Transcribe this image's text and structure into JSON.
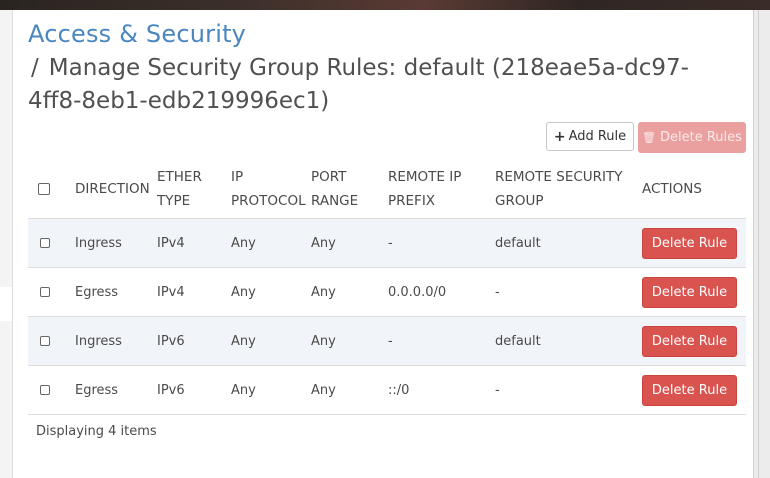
{
  "page": {
    "title": "Access & Security",
    "subtitle_slash": "/",
    "subtitle": "Manage Security Group Rules: default (218eae5a-dc97-4ff8-8eb1-edb219996ec1)"
  },
  "toolbar": {
    "add_rule_icon": "plus-icon",
    "add_rule_label": "Add Rule",
    "delete_rules_icon": "trash-icon",
    "delete_rules_label": "Delete Rules"
  },
  "table": {
    "columns": [
      {
        "line1": "DIRECTION",
        "line2": ""
      },
      {
        "line1": "ETHER",
        "line2": "TYPE"
      },
      {
        "line1": "IP",
        "line2": "PROTOCOL"
      },
      {
        "line1": "PORT",
        "line2": "RANGE"
      },
      {
        "line1": "REMOTE IP",
        "line2": "PREFIX"
      },
      {
        "line1": "REMOTE SECURITY",
        "line2": "GROUP"
      },
      {
        "line1": "ACTIONS",
        "line2": ""
      }
    ],
    "rows": [
      {
        "direction": "Ingress",
        "ether_type": "IPv4",
        "ip_protocol": "Any",
        "port_range": "Any",
        "remote_ip_prefix": "-",
        "remote_security_group": "default",
        "action": "Delete Rule"
      },
      {
        "direction": "Egress",
        "ether_type": "IPv4",
        "ip_protocol": "Any",
        "port_range": "Any",
        "remote_ip_prefix": "0.0.0.0/0",
        "remote_security_group": "-",
        "action": "Delete Rule"
      },
      {
        "direction": "Ingress",
        "ether_type": "IPv6",
        "ip_protocol": "Any",
        "port_range": "Any",
        "remote_ip_prefix": "-",
        "remote_security_group": "default",
        "action": "Delete Rule"
      },
      {
        "direction": "Egress",
        "ether_type": "IPv6",
        "ip_protocol": "Any",
        "port_range": "Any",
        "remote_ip_prefix": "::/0",
        "remote_security_group": "-",
        "action": "Delete Rule"
      }
    ],
    "footer": "Displaying 4 items"
  },
  "colors": {
    "title_blue": "#4a86c0",
    "danger": "#d9534f",
    "danger_disabled": "#eba0a0",
    "row_stripe": "#f1f4f8"
  }
}
